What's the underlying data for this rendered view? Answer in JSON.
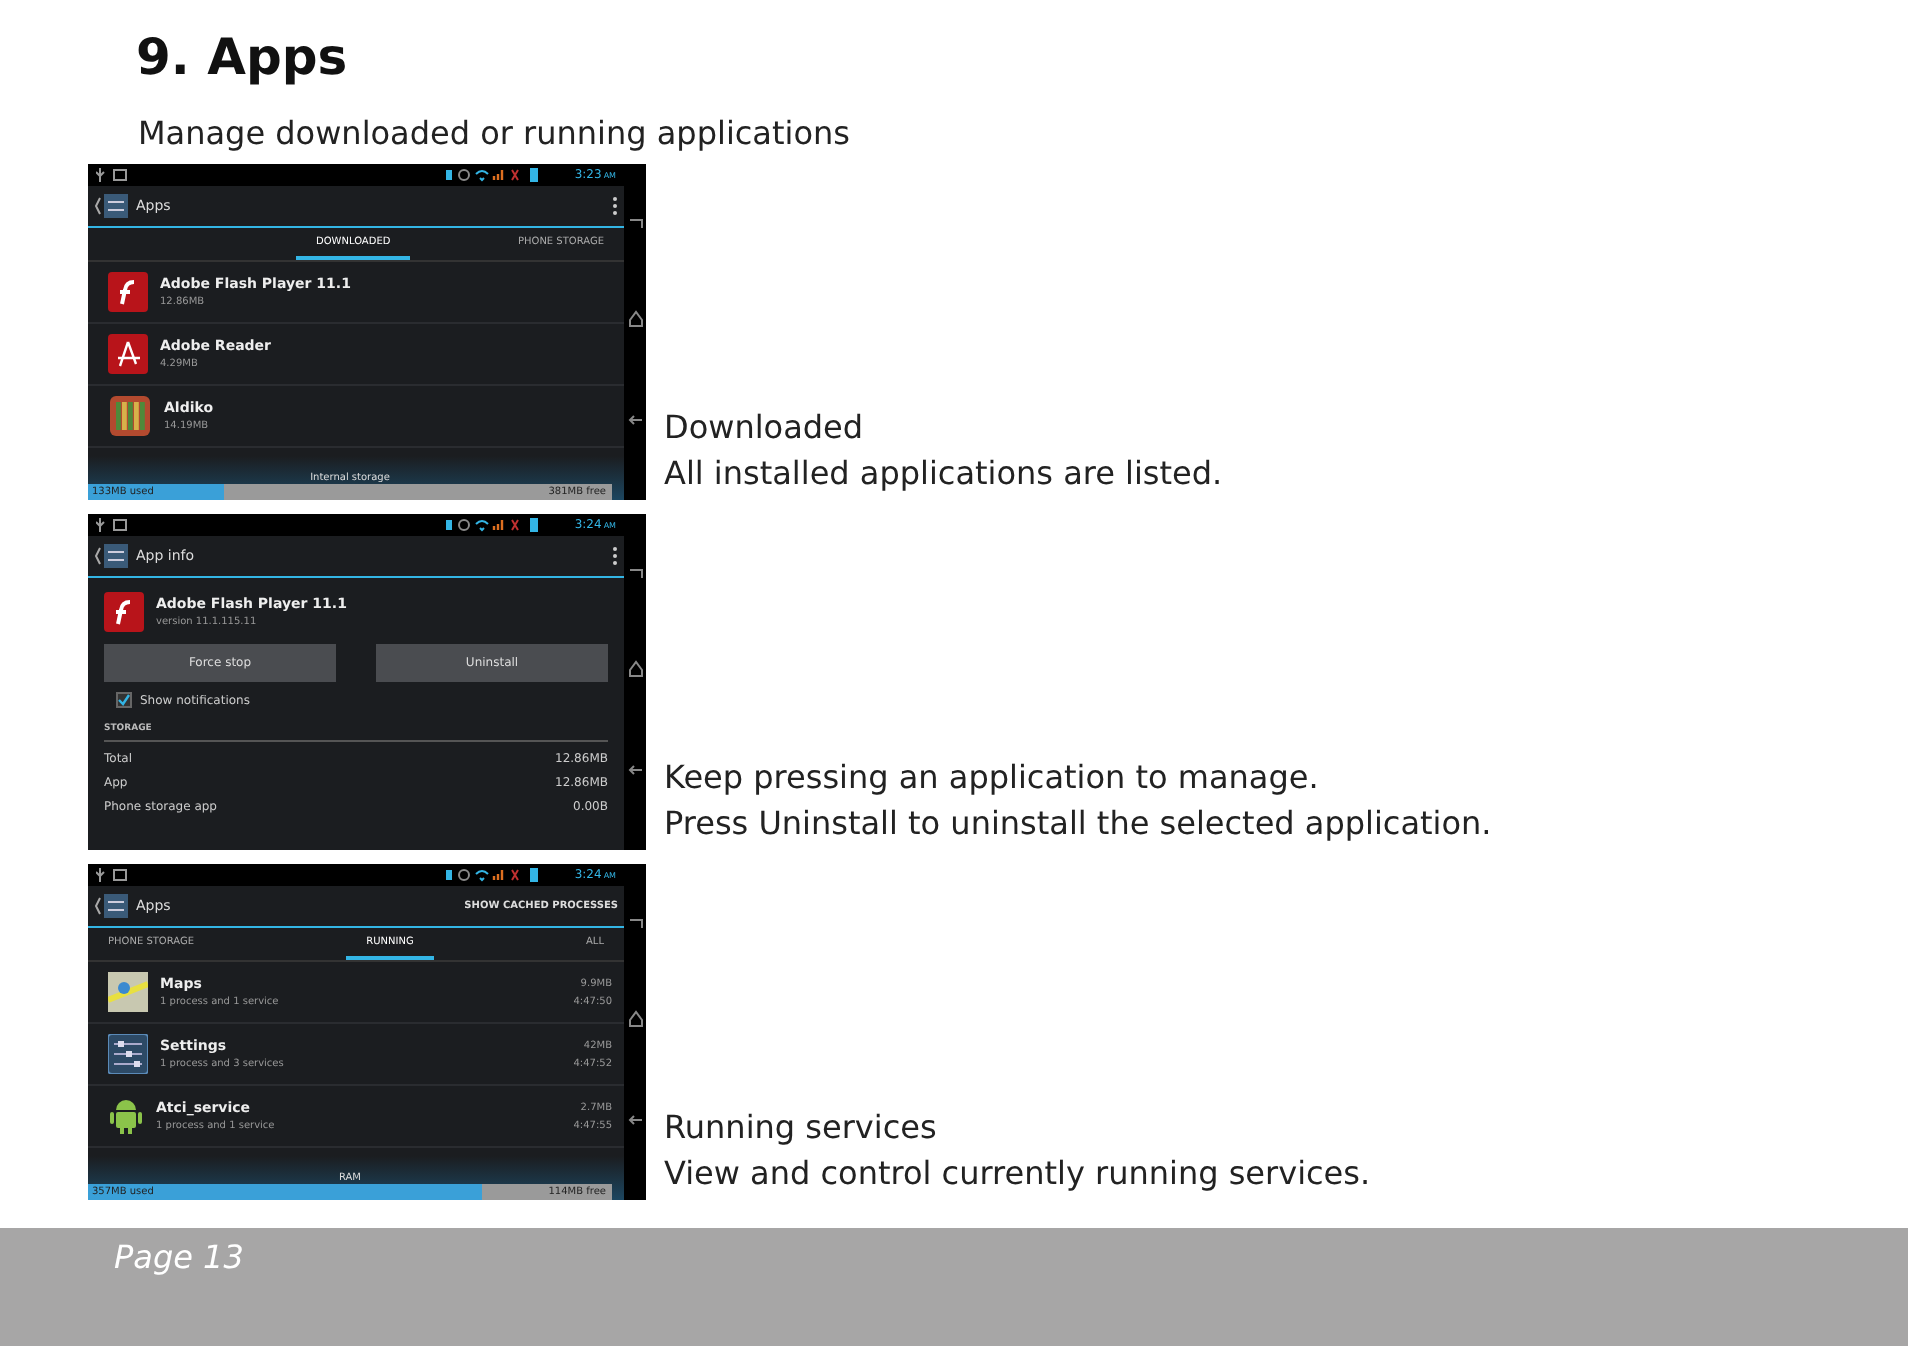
{
  "heading": "9. Apps",
  "intro": "Manage downloaded or running applications",
  "sections": [
    {
      "kind": "list",
      "screen": {
        "time": "3:23",
        "ampm": "AM",
        "title": "Apps",
        "tabs": [
          {
            "label": "DOWNLOADED",
            "selected": true
          },
          {
            "label": "PHONE STORAGE",
            "selected": false
          }
        ],
        "apps": [
          {
            "kind": "flash",
            "name": "Adobe Flash Player 11.1",
            "detail": "12.86MB"
          },
          {
            "kind": "reader",
            "name": "Adobe Reader",
            "detail": "4.29MB"
          },
          {
            "kind": "books",
            "name": "Aldiko",
            "detail": "14.19MB"
          }
        ],
        "storage": {
          "label": "Internal storage",
          "used": "133MB used",
          "free": "381MB free",
          "level": 0.26
        }
      },
      "caption": [
        "Downloaded",
        "All installed applications are listed."
      ]
    },
    {
      "kind": "info",
      "screen": {
        "time": "3:24",
        "ampm": "AM",
        "title": "App info",
        "app": {
          "kind": "flash",
          "name": "Adobe Flash Player 11.1",
          "detail": "version 11.1.115.11"
        },
        "buttons": [
          "Force stop",
          "Uninstall"
        ],
        "checkbox": {
          "label": "Show notifications",
          "checked": true
        },
        "section": "STORAGE",
        "rows": [
          {
            "label": "Total",
            "value": "12.86MB"
          },
          {
            "label": "App",
            "value": "12.86MB"
          },
          {
            "label": "Phone storage app",
            "value": "0.00B"
          }
        ]
      },
      "caption": [
        "Keep pressing an application to manage.",
        "Press Uninstall to uninstall the selected application."
      ]
    },
    {
      "kind": "list",
      "screen": {
        "time": "3:24",
        "ampm": "AM",
        "title": "Apps",
        "action": "SHOW CACHED PROCESSES",
        "tabs": [
          {
            "label": "PHONE STORAGE",
            "selected": false
          },
          {
            "label": "RUNNING",
            "selected": true
          },
          {
            "label": "ALL",
            "selected": false
          }
        ],
        "apps": [
          {
            "kind": "map",
            "name": "Maps",
            "detail": "1 process and 1 service",
            "size": "9.9MB",
            "time": "4:47:50"
          },
          {
            "kind": "settings",
            "name": "Settings",
            "detail": "1 process and 3 services",
            "size": "42MB",
            "time": "4:47:52"
          },
          {
            "kind": "android",
            "name": "Atci_service",
            "detail": "1 process and 1 service",
            "size": "2.7MB",
            "time": "4:47:55"
          }
        ],
        "storage": {
          "label": "RAM",
          "used": "357MB used",
          "free": "114MB free",
          "level": 0.75
        }
      },
      "caption": [
        "Running services",
        "View and control currently running services."
      ]
    }
  ],
  "footer": {
    "page": "Page 13"
  }
}
